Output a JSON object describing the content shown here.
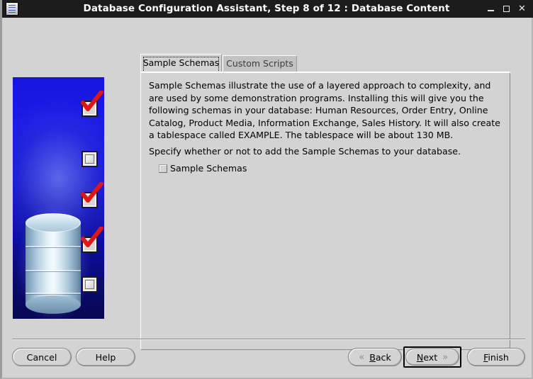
{
  "window": {
    "title": "Database Configuration Assistant, Step 8 of 12 : Database Content",
    "icon": "database-app-icon",
    "controls": {
      "minimize": "minimize-icon",
      "maximize": "maximize-icon",
      "close": "close-icon"
    }
  },
  "banner": {
    "image_name": "database-cylinder-illustration",
    "background_color": "#1212cf",
    "checkbox_markers": [
      {
        "state": "checked"
      },
      {
        "state": "unchecked"
      },
      {
        "state": "checked"
      },
      {
        "state": "checked"
      },
      {
        "state": "unchecked"
      }
    ]
  },
  "tabs": [
    {
      "label": "Sample Schemas",
      "selected": true
    },
    {
      "label": "Custom Scripts",
      "selected": false
    }
  ],
  "content": {
    "intro_paragraph": "Sample Schemas illustrate the use of a layered approach to complexity, and are used by some demonstration programs. Installing this will give you the following schemas in your database: Human Resources, Order Entry, Online Catalog, Product Media, Information Exchange, Sales History. It will also create a tablespace called EXAMPLE. The tablespace will be about 130 MB.",
    "specify_paragraph": "Specify whether or not to add the Sample Schemas to your database.",
    "sample_schemas_checkbox": {
      "label": "Sample Schemas",
      "checked": false
    }
  },
  "buttons": {
    "cancel": "Cancel",
    "help": "Help",
    "back": {
      "prefix": "B",
      "rest": "ack",
      "chevron": "«"
    },
    "next": {
      "prefix": "N",
      "rest": "ext",
      "chevron": "»",
      "is_default": true
    },
    "finish": {
      "prefix": "F",
      "rest": "inish"
    }
  }
}
